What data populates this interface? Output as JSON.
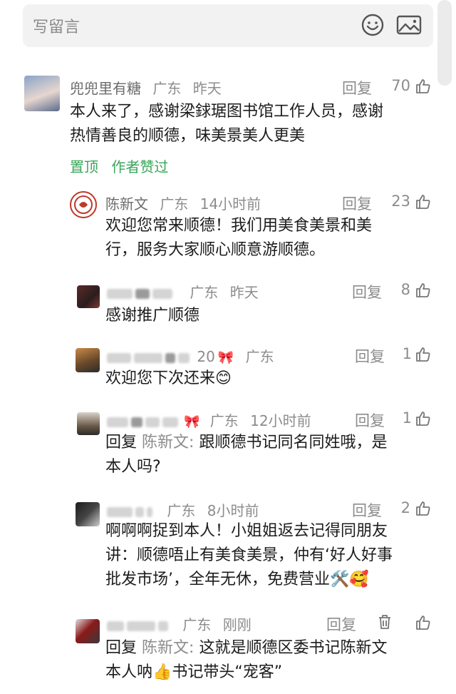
{
  "compose": {
    "placeholder": "写留言"
  },
  "comments": [
    {
      "name": "兜兜里有糖",
      "location": "广东",
      "time": "昨天",
      "reply_label": "回复",
      "likes": "70",
      "text_line1": "本人来了，感谢梁銶琚图书馆工作人员，感谢",
      "text_line2": "热情善良的顺德，味美景美人更美",
      "tags": [
        "置顶",
        "作者赞过"
      ]
    },
    {
      "name": "陈新文",
      "location": "广东",
      "time": "14小时前",
      "reply_label": "回复",
      "likes": "23",
      "text_line1": "欢迎您常来顺德！我们用美食美景和美",
      "text_line2": "行，服务大家顺心顺意游顺德。"
    },
    {
      "location": "广东",
      "time": "昨天",
      "reply_label": "回复",
      "likes": "8",
      "text_line1": "感谢推广顺德"
    },
    {
      "suffix": "20",
      "location": "广东",
      "reply_label": "回复",
      "likes": "1",
      "text_line1": "欢迎您下次还来😊"
    },
    {
      "location": "广东",
      "time": "12小时前",
      "reply_label": "回复",
      "likes": "1",
      "reply_prefix": "回复",
      "reply_to": "陈新文:",
      "text_line1": "跟顺德书记同名同姓哦，是",
      "text_line2": "本人吗?"
    },
    {
      "location": "广东",
      "time": "8小时前",
      "reply_label": "回复",
      "likes": "2",
      "text_line1": "啊啊啊捉到本人！小姐姐返去记得同朋友",
      "text_line2": "讲：顺德唔止有美食美景，仲有‘好人好事",
      "text_line3": "批发市场’，全年无休，免费营业🛠️🥰"
    },
    {
      "location": "广东",
      "time": "刚刚",
      "reply_label": "回复",
      "reply_prefix": "回复",
      "reply_to": "陈新文:",
      "text_line1": "这就是顺德区委书记陈新文",
      "text_line2": "本人呐👍书记带头“宠客”"
    }
  ],
  "icons": {
    "emoji": "smiley-face-icon",
    "image": "image-icon",
    "like": "thumbs-up-icon",
    "delete": "trash-icon"
  }
}
